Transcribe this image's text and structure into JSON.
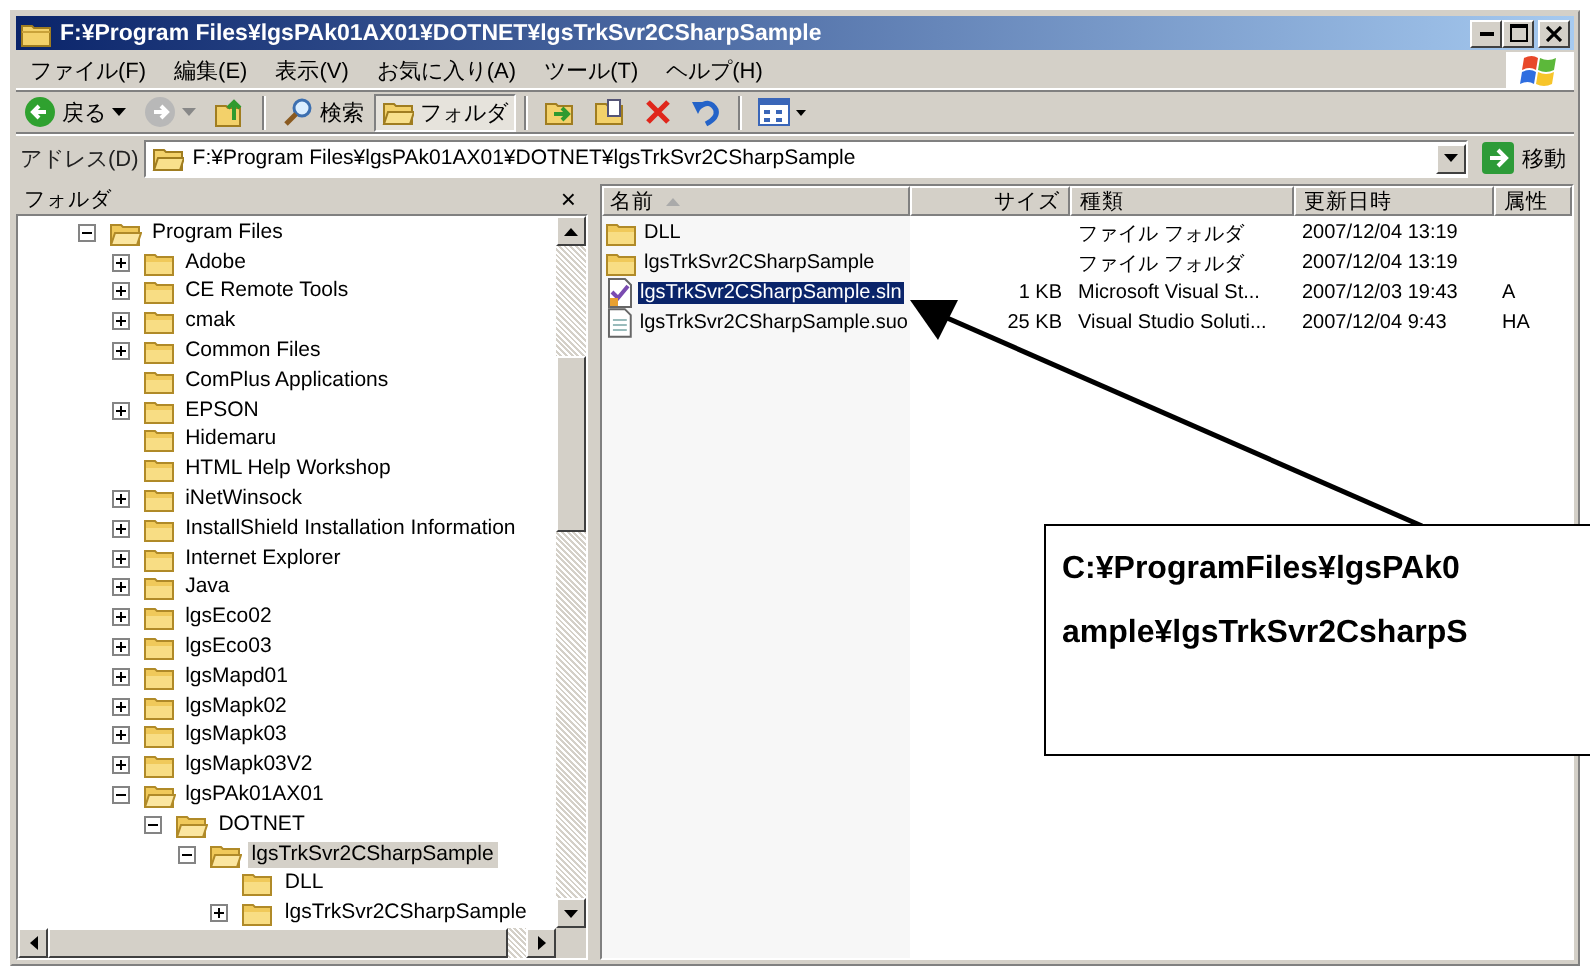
{
  "window": {
    "title": "F:¥Program Files¥lgsPAk01AX01¥DOTNET¥lgsTrkSvr2CSharpSample"
  },
  "menu": [
    "ファイル(F)",
    "編集(E)",
    "表示(V)",
    "お気に入り(A)",
    "ツール(T)",
    "ヘルプ(H)"
  ],
  "toolbar": {
    "back": "戻る",
    "search": "検索",
    "folders": "フォルダ",
    "folders_pressed": true
  },
  "address": {
    "label": "アドレス(D)",
    "value": "F:¥Program Files¥lgsPAk01AX01¥DOTNET¥lgsTrkSvr2CSharpSample",
    "go": "移動"
  },
  "folder_pane": {
    "title": "フォルダ",
    "close": "×"
  },
  "tree": [
    {
      "label": "Program Files",
      "kind": "branch",
      "expanded": true,
      "selected": false,
      "children": [
        {
          "label": "Adobe",
          "kind": "branch",
          "expanded": false,
          "selected": false
        },
        {
          "label": "CE Remote Tools",
          "kind": "branch",
          "expanded": false,
          "selected": false
        },
        {
          "label": "cmak",
          "kind": "branch",
          "expanded": false,
          "selected": false
        },
        {
          "label": "Common Files",
          "kind": "branch",
          "expanded": false,
          "selected": false
        },
        {
          "label": "ComPlus Applications",
          "kind": "leaf",
          "expanded": false,
          "selected": false
        },
        {
          "label": "EPSON",
          "kind": "branch",
          "expanded": false,
          "selected": false
        },
        {
          "label": "Hidemaru",
          "kind": "leaf",
          "expanded": false,
          "selected": false
        },
        {
          "label": "HTML Help Workshop",
          "kind": "leaf",
          "expanded": false,
          "selected": false
        },
        {
          "label": "iNetWinsock",
          "kind": "branch",
          "expanded": false,
          "selected": false
        },
        {
          "label": "InstallShield Installation Information",
          "kind": "branch",
          "expanded": false,
          "selected": false
        },
        {
          "label": "Internet Explorer",
          "kind": "branch",
          "expanded": false,
          "selected": false
        },
        {
          "label": "Java",
          "kind": "branch",
          "expanded": false,
          "selected": false
        },
        {
          "label": "lgsEco02",
          "kind": "branch",
          "expanded": false,
          "selected": false
        },
        {
          "label": "lgsEco03",
          "kind": "branch",
          "expanded": false,
          "selected": false
        },
        {
          "label": "lgsMapd01",
          "kind": "branch",
          "expanded": false,
          "selected": false
        },
        {
          "label": "lgsMapk02",
          "kind": "branch",
          "expanded": false,
          "selected": false
        },
        {
          "label": "lgsMapk03",
          "kind": "branch",
          "expanded": false,
          "selected": false
        },
        {
          "label": "lgsMapk03V2",
          "kind": "branch",
          "expanded": false,
          "selected": false
        },
        {
          "label": "lgsPAk01AX01",
          "kind": "branch",
          "expanded": true,
          "selected": false,
          "children": [
            {
              "label": "DOTNET",
              "kind": "branch",
              "expanded": true,
              "selected": false,
              "children": [
                {
                  "label": "lgsTrkSvr2CSharpSample",
                  "kind": "branch",
                  "expanded": true,
                  "selected": true,
                  "children": [
                    {
                      "label": "DLL",
                      "kind": "leaf",
                      "expanded": false,
                      "selected": false
                    },
                    {
                      "label": "lgsTrkSvr2CSharpSample",
                      "kind": "branch",
                      "expanded": false,
                      "selected": false
                    }
                  ]
                }
              ]
            }
          ]
        }
      ]
    }
  ],
  "file_list": {
    "columns": [
      {
        "label": "名前",
        "sorted": true
      },
      {
        "label": "サイズ",
        "sorted": false
      },
      {
        "label": "種類",
        "sorted": false
      },
      {
        "label": "更新日時",
        "sorted": false
      },
      {
        "label": "属性",
        "sorted": false
      }
    ],
    "rows": [
      {
        "kind": "folder",
        "name": "DLL",
        "type": "ファイル フォルダ",
        "modified": "2007/12/04 13:19",
        "selected": false
      },
      {
        "kind": "folder",
        "name": "lgsTrkSvr2CSharpSample",
        "type": "ファイル フォルダ",
        "modified": "2007/12/04 13:19",
        "selected": false
      },
      {
        "kind": "solution",
        "name": "lgsTrkSvr2CSharpSample.sln",
        "size": "1 KB",
        "type": "Microsoft Visual St...",
        "modified": "2007/12/03 19:43",
        "attributes": "A",
        "selected": true
      },
      {
        "kind": "document",
        "name": "lgsTrkSvr2CSharpSample.suo",
        "size": "25 KB",
        "type": "Visual Studio Soluti...",
        "modified": "2007/12/04 9:43",
        "attributes": "HA",
        "selected": false
      }
    ]
  },
  "callout": {
    "lines": [
      "C:¥ProgramFiles¥lgsPAk0",
      "ample¥lgsTrkSvr2CsharpS"
    ]
  }
}
